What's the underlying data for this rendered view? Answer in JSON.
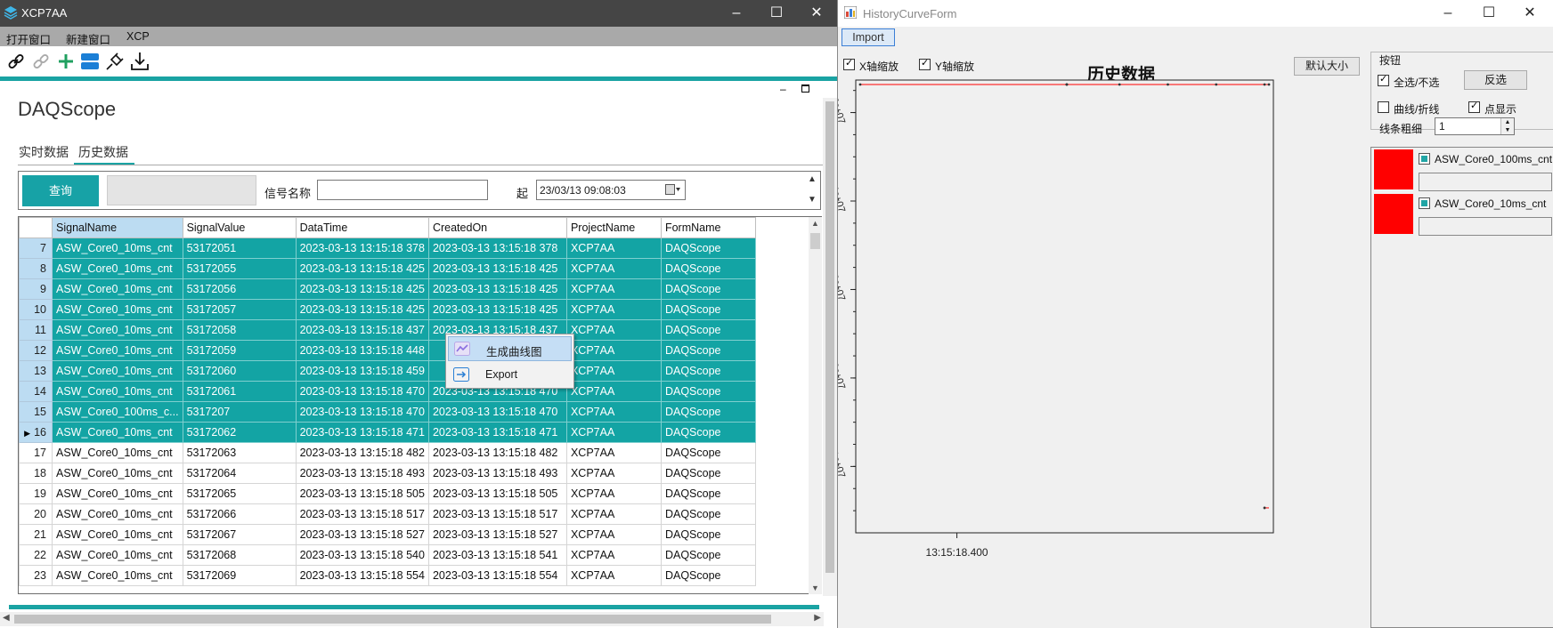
{
  "left_window": {
    "title": "XCP7AA",
    "menu": [
      "打开窗口",
      "新建窗口",
      "XCP"
    ],
    "toolbar_icons": [
      "link-icon",
      "unlink-icon",
      "add-icon",
      "layout-icon",
      "plugin-icon",
      "download-icon"
    ],
    "page_title": "DAQScope",
    "tabs": [
      {
        "label": "实时数据",
        "active": false
      },
      {
        "label": "历史数据",
        "active": true
      }
    ],
    "query": {
      "button_label": "查询",
      "signal_label": "信号名称",
      "signal_value": "",
      "start_label": "起",
      "start_value": "23/03/13 09:08:03"
    },
    "grid": {
      "columns": [
        "SignalName",
        "SignalValue",
        "DataTime",
        "CreatedOn",
        "ProjectName",
        "FormName"
      ],
      "rows": [
        {
          "n": "7",
          "sel": true,
          "cells": [
            "ASW_Core0_10ms_cnt",
            "53172051",
            "2023-03-13 13:15:18 378",
            "2023-03-13 13:15:18 378",
            "XCP7AA",
            "DAQScope"
          ]
        },
        {
          "n": "8",
          "sel": true,
          "cells": [
            "ASW_Core0_10ms_cnt",
            "53172055",
            "2023-03-13 13:15:18 425",
            "2023-03-13 13:15:18 425",
            "XCP7AA",
            "DAQScope"
          ]
        },
        {
          "n": "9",
          "sel": true,
          "cells": [
            "ASW_Core0_10ms_cnt",
            "53172056",
            "2023-03-13 13:15:18 425",
            "2023-03-13 13:15:18 425",
            "XCP7AA",
            "DAQScope"
          ]
        },
        {
          "n": "10",
          "sel": true,
          "cells": [
            "ASW_Core0_10ms_cnt",
            "53172057",
            "2023-03-13 13:15:18 425",
            "2023-03-13 13:15:18 425",
            "XCP7AA",
            "DAQScope"
          ]
        },
        {
          "n": "11",
          "sel": true,
          "cells": [
            "ASW_Core0_10ms_cnt",
            "53172058",
            "2023-03-13 13:15:18 437",
            "2023-03-13 13:15:18 437",
            "XCP7AA",
            "DAQScope"
          ]
        },
        {
          "n": "12",
          "sel": true,
          "cells": [
            "ASW_Core0_10ms_cnt",
            "53172059",
            "2023-03-13 13:15:18 448",
            "",
            "XCP7AA",
            "DAQScope"
          ]
        },
        {
          "n": "13",
          "sel": true,
          "cells": [
            "ASW_Core0_10ms_cnt",
            "53172060",
            "2023-03-13 13:15:18 459",
            "",
            "XCP7AA",
            "DAQScope"
          ]
        },
        {
          "n": "14",
          "sel": true,
          "cells": [
            "ASW_Core0_10ms_cnt",
            "53172061",
            "2023-03-13 13:15:18 470",
            "2023-03-13 13:15:18 470",
            "XCP7AA",
            "DAQScope"
          ]
        },
        {
          "n": "15",
          "sel": true,
          "cells": [
            "ASW_Core0_100ms_c...",
            "5317207",
            "2023-03-13 13:15:18 470",
            "2023-03-13 13:15:18 470",
            "XCP7AA",
            "DAQScope"
          ]
        },
        {
          "n": "16",
          "sel": true,
          "current": true,
          "cells": [
            "ASW_Core0_10ms_cnt",
            "53172062",
            "2023-03-13 13:15:18 471",
            "2023-03-13 13:15:18 471",
            "XCP7AA",
            "DAQScope"
          ]
        },
        {
          "n": "17",
          "sel": false,
          "cells": [
            "ASW_Core0_10ms_cnt",
            "53172063",
            "2023-03-13 13:15:18 482",
            "2023-03-13 13:15:18 482",
            "XCP7AA",
            "DAQScope"
          ]
        },
        {
          "n": "18",
          "sel": false,
          "cells": [
            "ASW_Core0_10ms_cnt",
            "53172064",
            "2023-03-13 13:15:18 493",
            "2023-03-13 13:15:18 493",
            "XCP7AA",
            "DAQScope"
          ]
        },
        {
          "n": "19",
          "sel": false,
          "cells": [
            "ASW_Core0_10ms_cnt",
            "53172065",
            "2023-03-13 13:15:18 505",
            "2023-03-13 13:15:18 505",
            "XCP7AA",
            "DAQScope"
          ]
        },
        {
          "n": "20",
          "sel": false,
          "cells": [
            "ASW_Core0_10ms_cnt",
            "53172066",
            "2023-03-13 13:15:18 517",
            "2023-03-13 13:15:18 517",
            "XCP7AA",
            "DAQScope"
          ]
        },
        {
          "n": "21",
          "sel": false,
          "cells": [
            "ASW_Core0_10ms_cnt",
            "53172067",
            "2023-03-13 13:15:18 527",
            "2023-03-13 13:15:18 527",
            "XCP7AA",
            "DAQScope"
          ]
        },
        {
          "n": "22",
          "sel": false,
          "cells": [
            "ASW_Core0_10ms_cnt",
            "53172068",
            "2023-03-13 13:15:18 540",
            "2023-03-13 13:15:18 541",
            "XCP7AA",
            "DAQScope"
          ]
        },
        {
          "n": "23",
          "sel": false,
          "cells": [
            "ASW_Core0_10ms_cnt",
            "53172069",
            "2023-03-13 13:15:18 554",
            "2023-03-13 13:15:18 554",
            "XCP7AA",
            "DAQScope"
          ]
        }
      ]
    },
    "context_menu": [
      {
        "label": "生成曲线图",
        "icon": "line-chart-icon",
        "highlighted": true
      },
      {
        "label": "Export",
        "icon": "export-icon",
        "highlighted": false
      }
    ]
  },
  "right_window": {
    "title": "HistoryCurveForm",
    "import_label": "Import",
    "x_zoom_label": "X轴缩放",
    "x_zoom_checked": true,
    "y_zoom_label": "Y轴缩放",
    "y_zoom_checked": true,
    "chart_title": "历史数据",
    "default_size_label": "默认大小",
    "buttons_group": {
      "title": "按钮",
      "select_all_label": "全选/不选",
      "select_all_checked": true,
      "invert_label": "反选",
      "curve_label": "曲线/折线",
      "curve_checked": false,
      "points_label": "点显示",
      "points_checked": true,
      "line_width_label": "线条粗细",
      "line_width_value": "1"
    },
    "series": [
      {
        "name": "ASW_Core0_100ms_cnt",
        "color": "#ff0000",
        "checked": true
      },
      {
        "name": "ASW_Core0_10ms_cnt",
        "color": "#ff0000",
        "checked": true
      }
    ]
  },
  "chart_data": {
    "type": "line",
    "title": "历史数据",
    "x_tick_labels": [
      "13:15:18.400"
    ],
    "y_tick_labels": [
      "1e+07",
      "2e+07",
      "3e+07",
      "4e+07",
      "5e+07"
    ],
    "ylim": [
      3000000,
      53172069
    ],
    "grid": false,
    "series": [
      {
        "name": "ASW_Core0_10ms_cnt",
        "color": "#ff0000",
        "points": [
          [
            "13:15:18.378",
            53172051
          ],
          [
            "13:15:18.425",
            53172055
          ],
          [
            "13:15:18.425",
            53172056
          ],
          [
            "13:15:18.425",
            53172057
          ],
          [
            "13:15:18.437",
            53172058
          ],
          [
            "13:15:18.448",
            53172059
          ],
          [
            "13:15:18.459",
            53172060
          ],
          [
            "13:15:18.470",
            53172061
          ],
          [
            "13:15:18.471",
            53172062
          ]
        ]
      },
      {
        "name": "ASW_Core0_100ms_cnt",
        "color": "#ff0000",
        "points": [
          [
            "13:15:18.470",
            5317207
          ]
        ]
      }
    ]
  }
}
